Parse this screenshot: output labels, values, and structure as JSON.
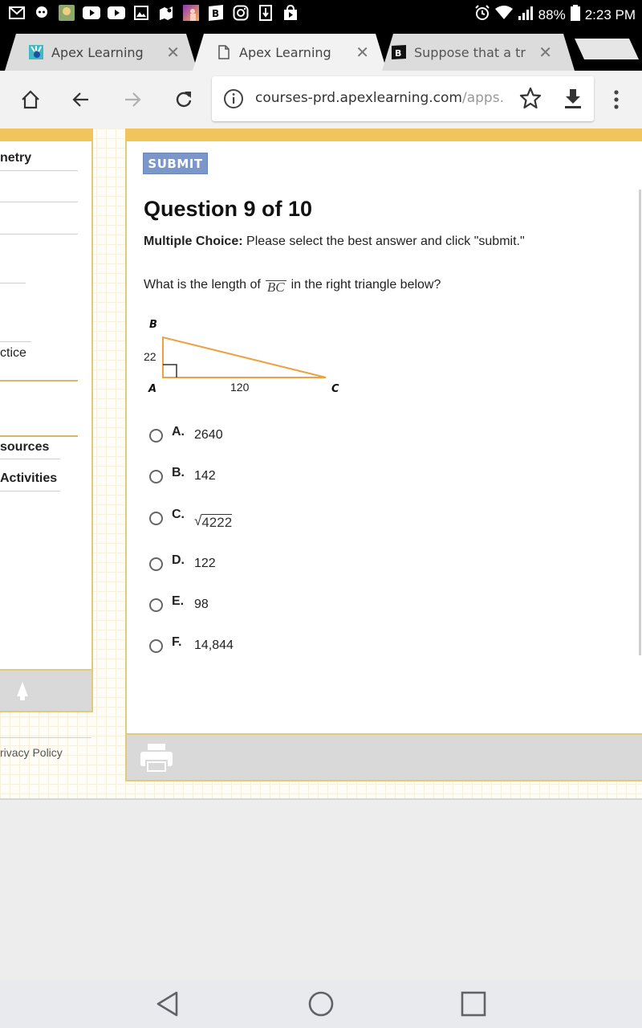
{
  "status_bar": {
    "left_icons": [
      "gmail-icon",
      "character-app-icon",
      "game-app-icon",
      "youtube-icon",
      "youtube-icon",
      "gallery-icon",
      "maps-icon",
      "photo-app-icon",
      "brainly-icon",
      "instagram-icon",
      "download-icon",
      "play-store-icon"
    ],
    "battery_percent": "88%",
    "time": "2:23 PM"
  },
  "browser": {
    "tabs": [
      {
        "title": "Apex Learning",
        "favicon": "apex-icon",
        "active": false
      },
      {
        "title": "Apex Learning",
        "favicon": "page-icon",
        "active": true
      },
      {
        "title": "Suppose that a tr",
        "favicon": "brainly-icon",
        "active": false
      }
    ],
    "url_host": "courses-prd.apexlearning.com",
    "url_path": "/apps."
  },
  "sidebar": {
    "items": [
      {
        "label": "netry",
        "bold": true
      },
      {
        "label": "ctice",
        "bold": false
      },
      {
        "label": "sources",
        "bold": true
      },
      {
        "label": "Activities",
        "bold": true
      }
    ],
    "privacy_label": "rivacy Policy"
  },
  "question": {
    "submit_label": "SUBMIT",
    "title": "Question 9 of 10",
    "instruction_bold": "Multiple Choice:",
    "instruction_text": "Please select the best answer and click \"submit.\"",
    "prompt_before": "What is the length of",
    "prompt_segment": "BC",
    "prompt_after": "in the right triangle below?",
    "diagram": {
      "vertex_b": "B",
      "vertex_a": "A",
      "vertex_c": "C",
      "side_ab": "22",
      "side_ac": "120"
    },
    "choices": [
      {
        "letter": "A.",
        "value": "2640"
      },
      {
        "letter": "B.",
        "value": "142"
      },
      {
        "letter": "C.",
        "value": "4222",
        "sqrt": true
      },
      {
        "letter": "D.",
        "value": "122"
      },
      {
        "letter": "E.",
        "value": "98"
      },
      {
        "letter": "F.",
        "value": "14,844"
      }
    ]
  },
  "colors": {
    "accent_gold": "#f2c55c",
    "submit_blue": "#7b96c9",
    "triangle_orange": "#f0a040"
  }
}
